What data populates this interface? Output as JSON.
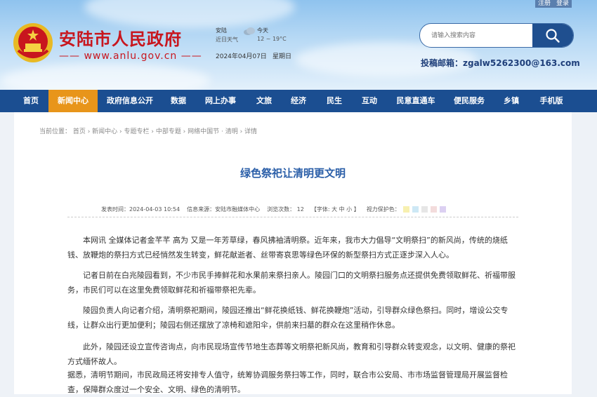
{
  "top_links": [
    "注册",
    "登录"
  ],
  "site": {
    "title": "安陆市人民政府",
    "url": "—— www.anlu.gov.cn ——"
  },
  "weather": {
    "city": "安陆",
    "desc": "近日天气",
    "today_label": "今天",
    "temp": "12 ~ 19°C",
    "icon": "cloud-icon",
    "date": "2024年04月07日",
    "weekday": "星期日"
  },
  "search": {
    "placeholder": "请输入搜索内容",
    "icon": "search-icon"
  },
  "mailbox": "投稿邮箱：zgalw5262300@163.com",
  "nav": [
    "首页",
    "新闻中心",
    "政府信息公开",
    "数据",
    "网上办事",
    "文旅",
    "经济",
    "民生",
    "互动",
    "民意直通车",
    "便民服务",
    "乡镇",
    "手机版"
  ],
  "nav_active": "新闻中心",
  "breadcrumb": "当前位置： 首页 › 新闻中心 › 专题专栏 › 中部专题 › 网络中国节 · 清明 › 详情",
  "article": {
    "title": "绿色祭祀让清明更文明",
    "publish_time": "发表时间：2024-04-03 10:54",
    "source": "信息来源：安陆市融媒体中心",
    "views": "浏览次数：  12",
    "font_size": "【字体:  大  中  小  】",
    "eye_protection": "视力保护色：",
    "paragraphs": [
      "本网讯 全媒体记者金芊芊 高为  又是一年芳草绿，春风拂袖清明祭。近年来，我市大力倡导“文明祭扫”的新风尚，传统的烧纸钱、放鞭炮的祭扫方式已经悄然发生转变，鲜花献逝者、丝带寄哀思等绿色环保的新型祭扫方式正逐步深入人心。",
      "记者日前在白兆陵园看到，不少市民手捧鲜花和水果前来祭扫亲人。陵园门口的文明祭扫服务点还提供免费领取鲜花、祈福带服务，市民们可以在这里免费领取鲜花和祈福带祭祀先辈。",
      "陵园负责人向记者介绍，清明祭祀期间，陵园还推出“鲜花换纸钱、鲜花换鞭炮”活动，引导群众绿色祭扫。同时，增设公交专线，让群众出行更加便利；陵园右侧还摆放了凉椅和遮阳伞，供前来扫墓的群众在这里稍作休息。",
      "此外，陵园还设立宣传咨询点，向市民现场宣传节地生态葬等文明祭祀新风尚，教育和引导群众转变观念，以文明、健康的祭祀方式缅怀故人。",
      "据悉，清明节期间，市民政局还将安排专人值守，统筹协调服务祭扫等工作，同时，联合市公安局、市市场监督管理局开展监督检查，保障群众度过一个安全、文明、绿色的清明节。"
    ]
  },
  "colors": {
    "nav_bg": "#1b4e91",
    "nav_active": "#e8951a",
    "title_red": "#c8161e",
    "article_title": "#2a5ea8",
    "swatches": [
      "#f7f0b0",
      "#cde8f5",
      "#e6e6e6",
      "#f3dcdc",
      "#dcd0f2"
    ]
  }
}
